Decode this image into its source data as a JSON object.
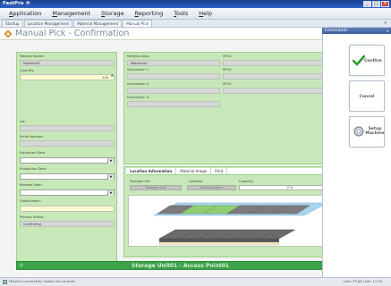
{
  "app": {
    "title": "FastPro ®",
    "window_buttons": [
      "_",
      "□",
      "×"
    ]
  },
  "menu": [
    "Application",
    "Management",
    "Storage",
    "Reporting",
    "Tools",
    "Help"
  ],
  "tabs": [
    {
      "label": "Startup",
      "active": false
    },
    {
      "label": "Location Management",
      "active": false
    },
    {
      "label": "Material Management",
      "active": false
    },
    {
      "label": "Manual Pick",
      "active": true
    }
  ],
  "tab_close": "×",
  "page": {
    "title": "Manual Pick - Confirmation",
    "icon": "pick-icon"
  },
  "left": {
    "material_name_label": "Material Name:",
    "material_name_value": "Material01",
    "quantity_label": "Quantity:",
    "quantity_value": "120",
    "lot_label": "Lot:",
    "serial_label": "Serial Number:",
    "expiration_label": "Expiration Date:",
    "production_label": "Production Date:",
    "release_label": "Release Date:",
    "qualification_label": "Qualification:",
    "process_status_label": "Process Status:",
    "process_status_value": "Confirming"
  },
  "right": {
    "material_alias_label": "Material Alias:",
    "material_alias_value": "Material01",
    "description1_label": "Description 1:",
    "description2_label": "Description 2:",
    "description3_label": "Description 3:",
    "spare1_label": "SPV1:",
    "spare2_label": "SPV2:",
    "spare3_label": "SPV3:"
  },
  "location": {
    "tabs": [
      {
        "label": "Location Information",
        "active": true
      },
      {
        "label": "Material Image",
        "active": false
      },
      {
        "label": "Print",
        "active": false
      }
    ],
    "storage_unit_label": "Storage Unit:",
    "location_label": "Location:",
    "capacity_label": "Capacity:",
    "storage_unit_btn": "Storage Unit",
    "location_btn": "Shelf/Location",
    "capacity_value": "0 %",
    "capacity_fraction": 0.0,
    "colors": {
      "tray_gray": "#7b7b7b",
      "tray_green": "#8fcf72",
      "shelf_blue": "#a8d4ec"
    }
  },
  "status": {
    "banner": "Storage Unit01 - Access Point01",
    "left_text": "Material successfully loaded into location",
    "right_text": "User: FP-AD User: 11:24"
  },
  "commands": {
    "header": "Commands",
    "confirm": "Confirm",
    "cancel": "Cancel",
    "setup_machine": "Setup Machine"
  }
}
